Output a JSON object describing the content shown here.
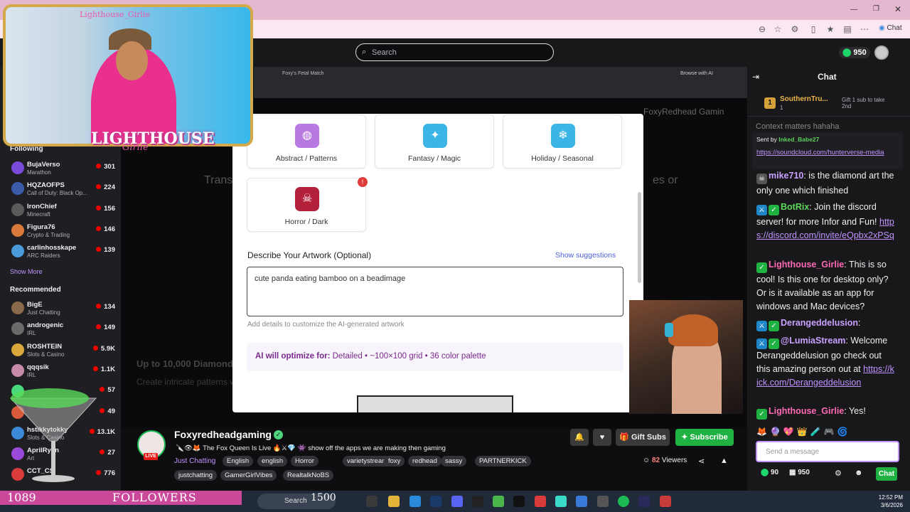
{
  "browser": {
    "chat_label": "Chat"
  },
  "top": {
    "search_placeholder": "Search",
    "points": "950"
  },
  "inner": {
    "tab_title": "Foxy's Fetal Match",
    "browse_ai": "Browse with AI"
  },
  "sidebar": {
    "following_title": "Following",
    "following": [
      {
        "name": "BujaVerso",
        "game": "Marathon",
        "viewers": "301",
        "color": "#7a4ad9"
      },
      {
        "name": "HQZAOFPS",
        "game": "Call of Duty: Black Op...",
        "viewers": "224",
        "color": "#3b5ba9"
      },
      {
        "name": "IronChief",
        "game": "Minecraft",
        "viewers": "156",
        "color": "#5a5a5a"
      },
      {
        "name": "Figura76",
        "game": "Crypto & Trading",
        "viewers": "146",
        "color": "#d97a3a"
      },
      {
        "name": "carlinhosskape",
        "game": "ARC Raiders",
        "viewers": "139",
        "color": "#4a9ad9"
      }
    ],
    "show_more": "Show More",
    "recommended_title": "Recommended",
    "recommended": [
      {
        "name": "BigE",
        "game": "Just Chatting",
        "viewers": "134",
        "color": "#8a6a4a"
      },
      {
        "name": "androgenic",
        "game": "IRL",
        "viewers": "149",
        "color": "#6a6a6a"
      },
      {
        "name": "ROSHTEIN",
        "game": "Slots & Casino",
        "viewers": "5.9K",
        "color": "#d9a83a"
      },
      {
        "name": "qqqsik",
        "game": "IRL",
        "viewers": "1.1K",
        "color": "#c78aa9"
      },
      {
        "name": "",
        "game": "",
        "viewers": "57",
        "color": "#4ad97a"
      },
      {
        "name": "",
        "game": "",
        "viewers": "49",
        "color": "#d95a3a"
      },
      {
        "name": "hstikkytokky",
        "game": "Slots & Casino",
        "viewers": "13.1K",
        "color": "#3a8ad9"
      },
      {
        "name": "AprilRyan",
        "game": "Art",
        "viewers": "27",
        "color": "#9a4ad9"
      },
      {
        "name": "CCT_CS",
        "game": "",
        "viewers": "776",
        "color": "#d93a3a"
      }
    ]
  },
  "background": {
    "left_text": "Trans",
    "right_text": "es or",
    "up_to": "Up to 10,000 Diamond",
    "create": "Create intricate patterns w",
    "foxy": "FoxyRedhead Gamin"
  },
  "modal": {
    "cards": [
      {
        "label": "Abstract / Patterns",
        "icon": "palette-icon",
        "color": "#b77ae0"
      },
      {
        "label": "Fantasy / Magic",
        "icon": "wand-icon",
        "color": "#3bb5e5"
      },
      {
        "label": "Holiday / Seasonal",
        "icon": "snowflake-icon",
        "color": "#3bb5e5"
      },
      {
        "label": "Horror / Dark",
        "icon": "skull-icon",
        "color": "#b3223a"
      }
    ],
    "warn": "!",
    "describe_title": "Describe Your Artwork (Optional)",
    "show_suggestions": "Show suggestions",
    "description_value": "cute panda eating bamboo on a beadimage",
    "helper": "Add details to customize the AI-generated artwork",
    "optimize_label": "AI will optimize for:",
    "optimize_value": "Detailed • ~100×100 grid • 36 color palette"
  },
  "overlay": {
    "cam_title": "Lighthouse_Girlie",
    "logo_top": "LIGHTHOUSE",
    "logo_bottom": "Girlie"
  },
  "stream": {
    "name": "Foxyredheadgaming",
    "live": "LIVE",
    "title": "🔪👁🦊 The Fox Queen Is Live 🔥⚔💎 👾 show off the apps we are making then gaming",
    "category": "Just Chatting",
    "tags": [
      "English",
      "english",
      "Horror",
      "varietystreamer",
      "foxy",
      "redhead",
      "sassy",
      "PARTNERKICK",
      "justchatting",
      "GamerGirlVibes",
      "RealtalkNoBS"
    ],
    "gift_subs": "Gift Subs",
    "subscribe": "Subscribe",
    "viewers_count": "82",
    "viewers_label": "Viewers"
  },
  "chat": {
    "title": "Chat",
    "top_user": "SouthernTru...",
    "top_user_count": "1",
    "gift_text": "Gift 1 sub to take 2nd",
    "context": "Context matters hahaha",
    "pinned_sent_by": "Sent by",
    "pinned_user": "Inked_Babe27",
    "pinned_link": "https://soundcloud.com/hunterverse-media",
    "messages": [
      {
        "user": "mike710",
        "color": "#c9a1ff",
        "text": ": is the diamond art the only one which finished"
      },
      {
        "user": "BotRix",
        "color": "#5dd95d",
        "text": ": Join the discord server! for more Infor and Fun! ",
        "link": "https://discord.com/invite/eQpbx2xPSq"
      },
      {
        "user": "Lighthouse_Girlie",
        "color": "#ff69b4",
        "text": ": This is so cool! Is this one for desktop only? Or is it available as an app for windows and Mac devices?"
      },
      {
        "user": "Derangeddelusion",
        "color": "#c9a1ff",
        "text": ":"
      },
      {
        "user": "@LumiaStream",
        "color": "#c9a1ff",
        "text": ": Welcome Derangeddelusion go check out this amazing person out at ",
        "link": "https://kick.com/Derangeddelusion"
      },
      {
        "user": "Lighthouse_Girlie",
        "color": "#ff69b4",
        "text": ": Yes!"
      }
    ],
    "input_placeholder": "Send a message",
    "points_a": "90",
    "points_b": "950",
    "chat_button": "Chat"
  },
  "followers": {
    "count": "1089",
    "label": "FOLLOWERS"
  },
  "taskbar": {
    "search": "Search",
    "counter": "1500",
    "time": "12:52 PM",
    "date": "3/6/2026"
  }
}
